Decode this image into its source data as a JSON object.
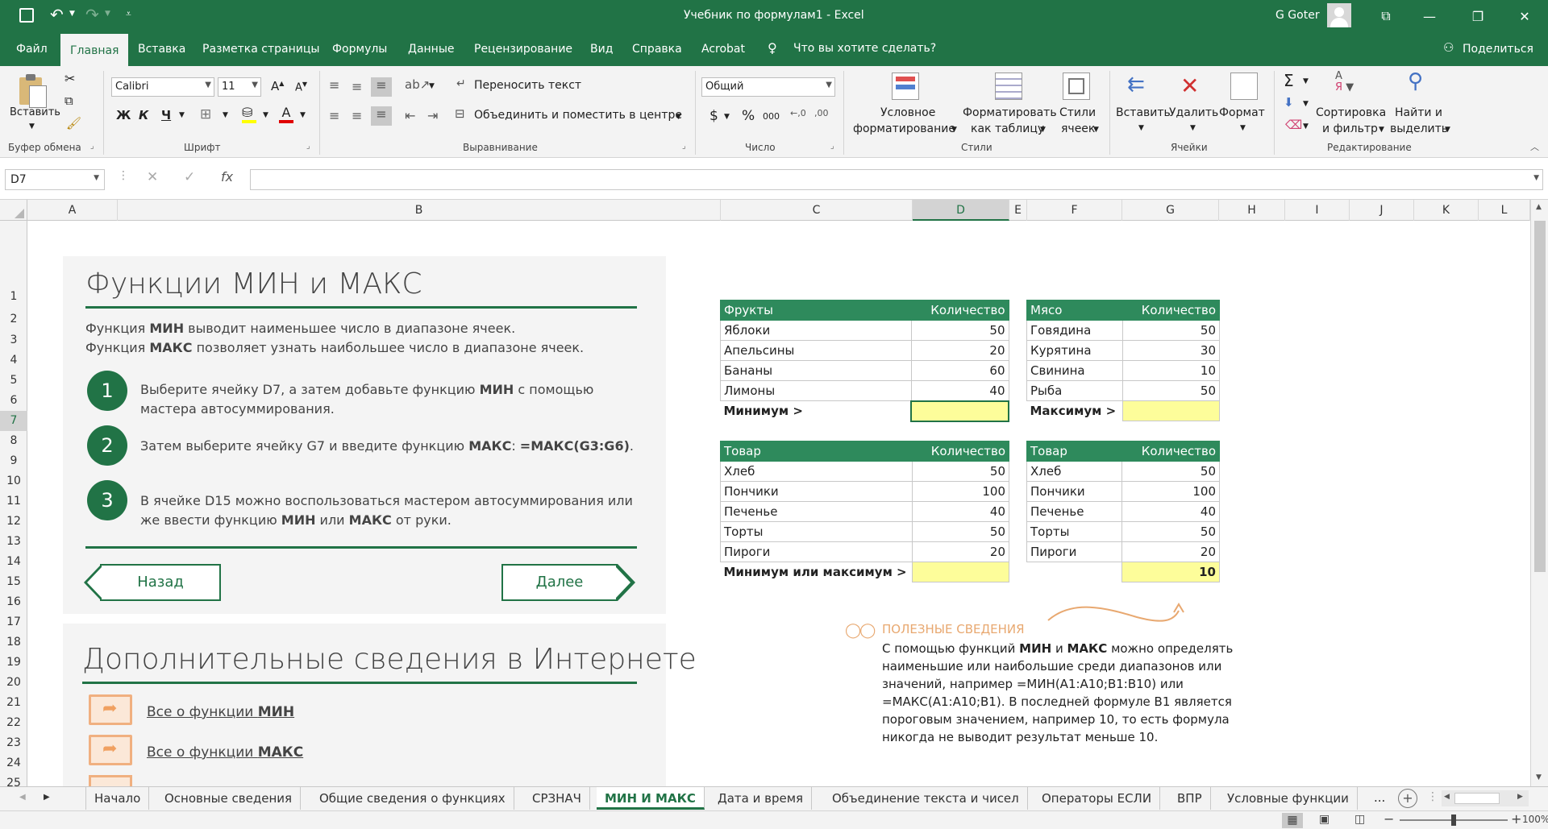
{
  "window": {
    "title": "Учебник по формулам1  -  Excel",
    "user": "G Goter"
  },
  "tabs": [
    "Файл",
    "Главная",
    "Вставка",
    "Разметка страницы",
    "Формулы",
    "Данные",
    "Рецензирование",
    "Вид",
    "Справка",
    "Acrobat"
  ],
  "tell_me": "Что вы хотите сделать?",
  "share": "Поделиться",
  "ribbon": {
    "paste": "Вставить",
    "clipboard_group": "Буфер обмена",
    "font_name": "Calibri",
    "font_size": "11",
    "font_group": "Шрифт",
    "bold": "Ж",
    "italic": "К",
    "underline": "Ч",
    "wrap_text": "Переносить текст",
    "merge_center": "Объединить и поместить в центре",
    "align_group": "Выравнивание",
    "number_format": "Общий",
    "number_group": "Число",
    "cond_format_1": "Условное",
    "cond_format_2": "форматирование",
    "format_table_1": "Форматировать",
    "format_table_2": "как таблицу",
    "cell_styles_1": "Стили",
    "cell_styles_2": "ячеек",
    "styles_group": "Стили",
    "insert": "Вставить",
    "delete": "Удалить",
    "format": "Формат",
    "cells_group": "Ячейки",
    "sort_1": "Сортировка",
    "sort_2": "и фильтр",
    "find_1": "Найти и",
    "find_2": "выделить",
    "editing_group": "Редактирование"
  },
  "formula_bar": {
    "name_box": "D7",
    "fx": "fx",
    "value": ""
  },
  "columns": [
    "A",
    "B",
    "C",
    "D",
    "E",
    "F",
    "G",
    "H",
    "I",
    "J",
    "K",
    "L"
  ],
  "rows": [
    "1",
    "2",
    "3",
    "4",
    "5",
    "6",
    "7",
    "8",
    "9",
    "10",
    "11",
    "12",
    "13",
    "14",
    "15",
    "16",
    "17",
    "18",
    "19",
    "20",
    "21",
    "22",
    "23",
    "24",
    "25"
  ],
  "lesson": {
    "title": "Функции МИН и МАКС",
    "intro_1_pre": "Функция ",
    "intro_1_bold": "МИН",
    "intro_1_post": " выводит наименьшее число в диапазоне ячеек.",
    "intro_2_pre": "Функция ",
    "intro_2_bold": "МАКС",
    "intro_2_post": " позволяет узнать наибольшее число в диапазоне ячеек.",
    "step1_num": "1",
    "step1_a": "Выберите ячейку D7, а затем добавьте функцию ",
    "step1_b": "МИН",
    "step1_c": " с помощью",
    "step1_d": "мастера автосуммирования.",
    "step2_num": "2",
    "step2_a": "Затем выберите ячейку G7 и введите функцию ",
    "step2_b": "МАКС",
    "step2_c": ": ",
    "step2_d": "=МАКС(G3:G6)",
    "step2_e": ".",
    "step3_num": "3",
    "step3_a": "В ячейке D15 можно воспользоваться мастером автосуммирования или",
    "step3_b": "же ввести функцию ",
    "step3_c": "МИН",
    "step3_d": " или ",
    "step3_e": "МАКС",
    "step3_f": " от руки.",
    "back": "Назад",
    "next": "Далее"
  },
  "more": {
    "title": "Дополнительные сведения в Интернете",
    "link1_pre": "Все о функции ",
    "link1_bold": "МИН",
    "link2_pre": "Все о функции ",
    "link2_bold": "МАКС"
  },
  "table_fruits": {
    "h1": "Фрукты",
    "h2": "Количество",
    "rows": [
      [
        "Яблоки",
        "50"
      ],
      [
        "Апельсины",
        "20"
      ],
      [
        "Бананы",
        "60"
      ],
      [
        "Лимоны",
        "40"
      ]
    ],
    "footer": "Минимум >",
    "result": ""
  },
  "table_meat": {
    "h1": "Мясо",
    "h2": "Количество",
    "rows": [
      [
        "Говядина",
        "50"
      ],
      [
        "Курятина",
        "30"
      ],
      [
        "Свинина",
        "10"
      ],
      [
        "Рыба",
        "50"
      ]
    ],
    "footer": "Максимум >",
    "result": ""
  },
  "table_goods1": {
    "h1": "Товар",
    "h2": "Количество",
    "rows": [
      [
        "Хлеб",
        "50"
      ],
      [
        "Пончики",
        "100"
      ],
      [
        "Печенье",
        "40"
      ],
      [
        "Торты",
        "50"
      ],
      [
        "Пироги",
        "20"
      ]
    ],
    "footer": "Минимум или максимум >",
    "result": ""
  },
  "table_goods2": {
    "h1": "Товар",
    "h2": "Количество",
    "rows": [
      [
        "Хлеб",
        "50"
      ],
      [
        "Пончики",
        "100"
      ],
      [
        "Печенье",
        "40"
      ],
      [
        "Торты",
        "50"
      ],
      [
        "Пироги",
        "20"
      ]
    ],
    "result": "10"
  },
  "tip": {
    "title": "ПОЛЕЗНЫЕ СВЕДЕНИЯ",
    "l1_a": "С помощью функций ",
    "l1_b": "МИН",
    "l1_c": " и ",
    "l1_d": "МАКС",
    "l1_e": " можно определять",
    "l2": "наименьшие или наибольшие среди диапазонов или",
    "l3": "значений, например =МИН(A1:A10;B1:B10) или",
    "l4": "=МАКС(A1:A10;B1). В последней формуле B1 является",
    "l5": "пороговым значением, например 10, то есть формула",
    "l6": "никогда не выводит результат меньше 10."
  },
  "sheets": [
    "Начало",
    "Основные сведения",
    "Общие сведения о функциях",
    "СРЗНАЧ",
    "МИН И МАКС",
    "Дата и время",
    "Объединение текста и чисел",
    "Операторы ЕСЛИ",
    "ВПР",
    "Условные функции"
  ],
  "sheet_more": "...",
  "zoom": "100%",
  "colors": {
    "accent": "#217346",
    "table_header": "#2e8a5c",
    "highlight": "#fdfd9a",
    "tip": "#e8a870"
  }
}
